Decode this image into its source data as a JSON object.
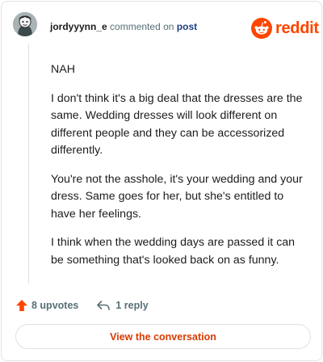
{
  "comment": {
    "username": "jordyyynn_e",
    "action_text": "commented on",
    "post_link_label": "post",
    "avatar_icon": "user-avatar",
    "body": [
      "NAH",
      "I don't think it's a big deal that the dresses are the same. Wedding dresses will look different on different people and they can be accessorized differently.",
      "You're not the asshole, it's your wedding and your dress. Same goes for her, but she's entitled to have her feelings.",
      "I think when the wedding days are passed it can be something that's looked back on as funny."
    ]
  },
  "brand": {
    "wordmark": "reddit",
    "icon": "reddit-snoo-icon",
    "color": "#ff4500"
  },
  "footer": {
    "upvotes_label": "8 upvotes",
    "upvote_icon": "upvote-arrow-icon",
    "upvote_color": "#ff4500",
    "replies_label": "1 reply",
    "reply_icon": "reply-arrow-icon"
  },
  "cta": {
    "label": "View the conversation",
    "color": "#d93a00"
  }
}
